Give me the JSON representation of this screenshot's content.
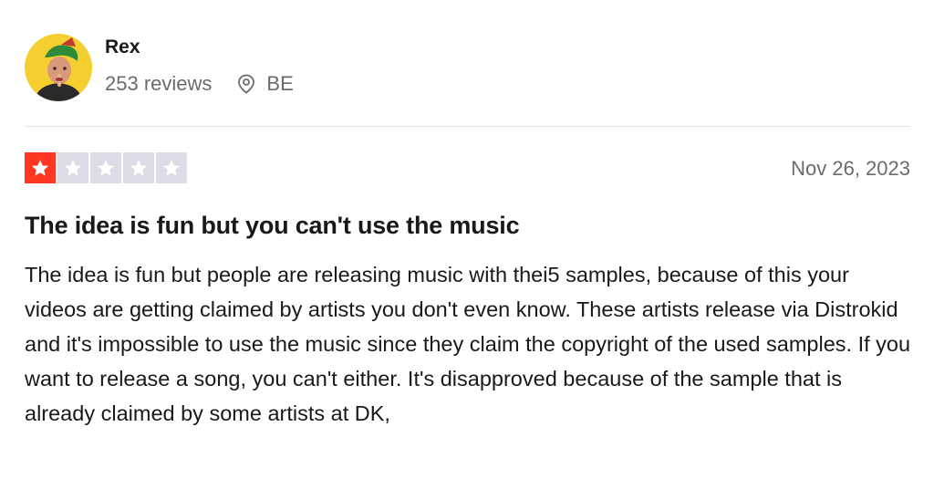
{
  "reviewer": {
    "name": "Rex",
    "reviews_count": "253 reviews",
    "location": "BE",
    "avatar_icon": "avatar-photo"
  },
  "rating": {
    "value": 1,
    "max": 5,
    "filled_color": "#ff3722",
    "empty_color": "#dcdce6"
  },
  "review": {
    "date": "Nov 26, 2023",
    "title": "The idea is fun but you can't use the music",
    "body": "The idea is fun but people are releasing music with thei5 samples, because of this your videos are getting claimed by artists you don't even know. These artists release via Distrokid and it's impossible to use the music since they claim the copyright of the used samples. If you want to release a song, you can't either. It's disapproved because of the sample that is already claimed by some artists at DK,"
  }
}
